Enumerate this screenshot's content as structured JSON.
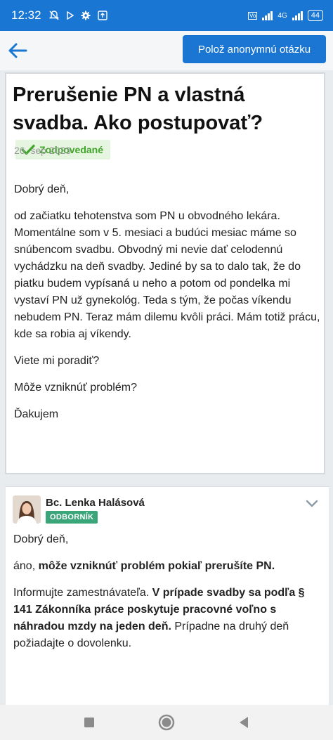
{
  "status": {
    "time": "12:32",
    "battery": "44",
    "net_small": "4G"
  },
  "appbar": {
    "ask_button": "Polož anonymnú otázku"
  },
  "question": {
    "title": "Prerušenie PN a vlastná svadba. Ako postupovať?",
    "badge": "Zodpovedané",
    "date": "26. sep 2023",
    "paragraphs": [
      "Dobrý deň,",
      "od začiatku tehotenstva som PN u obvodného lekára. Momentálne som v 5. mesiaci a budúci mesiac máme so snúbencom svadbu. Obvodný mi nevie dať celodennú vychádzku na deň svadby. Jediné by sa to dalo tak, že do piatku budem vypísaná u neho a potom od pondelka mi vystaví PN už gynekológ. Teda s tým, že počas víkendu nebudem PN. Teraz mám dilemu kvôli práci. Mám totiž prácu, kde sa robia aj víkendy.",
      "Viete mi poradiť?",
      "Môže vzniknúť problém?",
      "Ďakujem"
    ]
  },
  "answer": {
    "author": "Bc. Lenka Halásová",
    "role": "ODBORNÍK",
    "greeting": "Dobrý deň,",
    "p2_a": "áno, ",
    "p2_b": "môže vzniknúť problém pokiaľ prerušíte PN.",
    "p3_a": "Informujte zamestnávateľa. ",
    "p3_b": "V prípade svadby sa podľa § 141 Zákonníka práce poskytuje pracovné voľno s náhradou mzdy na jeden deň.",
    "p3_c": " Prípadne na druhý deň požiadajte o dovolenku."
  },
  "colors": {
    "primary": "#1976d2",
    "success": "#3fa52a",
    "expert": "#3ba57a"
  }
}
